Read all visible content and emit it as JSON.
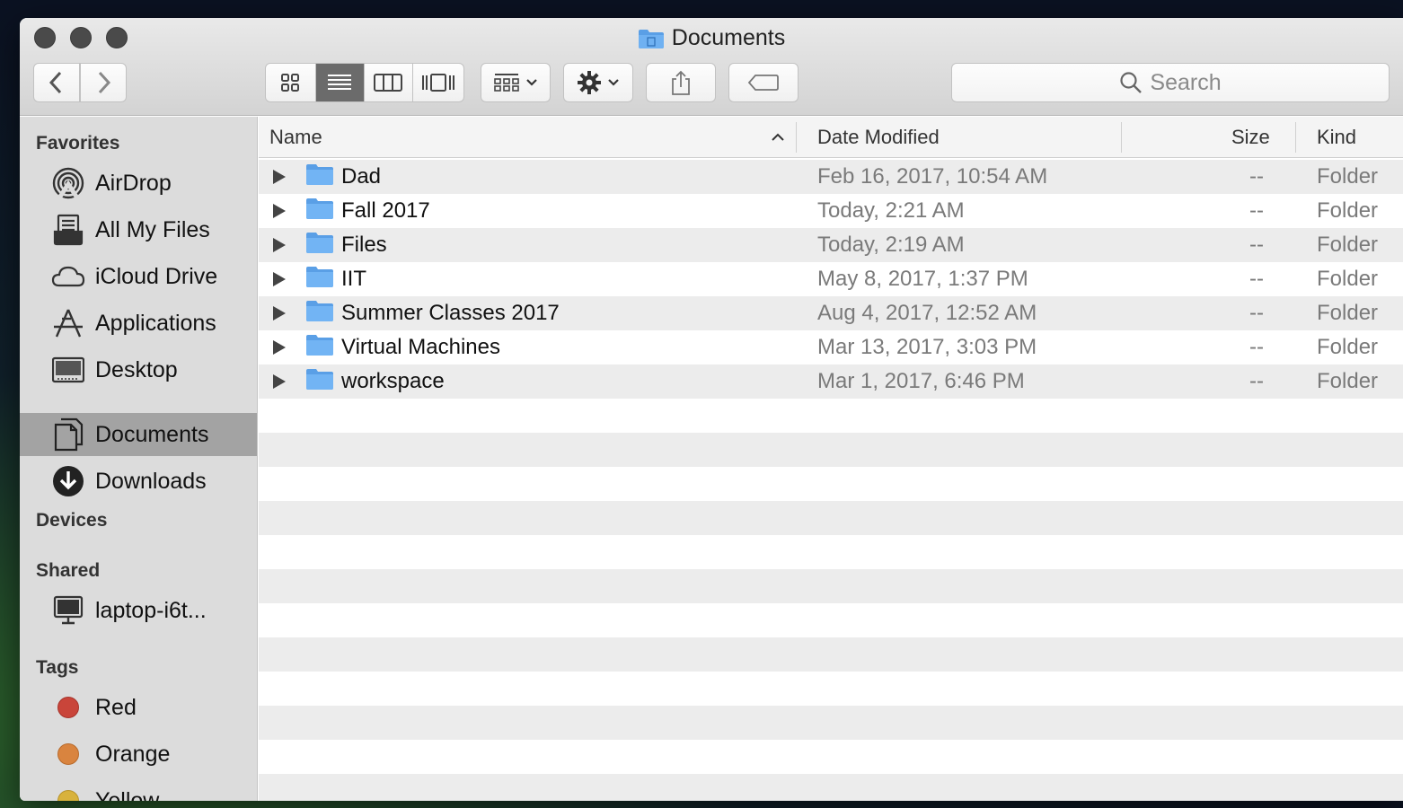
{
  "window": {
    "title": "Documents"
  },
  "toolbar": {
    "back_icon": "chevron-left-icon",
    "forward_icon": "chevron-right-icon",
    "views": [
      "icon-view",
      "list-view",
      "column-view",
      "cover-flow-view"
    ],
    "active_view": "list-view",
    "arrange_icon": "arrange-grid-icon",
    "action_icon": "gear-icon",
    "share_icon": "share-icon",
    "tag_icon": "tag-icon",
    "search_placeholder": "Search"
  },
  "sidebar": {
    "favorites_header": "Favorites",
    "favorites": [
      {
        "label": "AirDrop",
        "icon": "airdrop-icon"
      },
      {
        "label": "All My Files",
        "icon": "all-files-icon"
      },
      {
        "label": "iCloud Drive",
        "icon": "cloud-icon"
      },
      {
        "label": "Applications",
        "icon": "applications-icon"
      },
      {
        "label": "Desktop",
        "icon": "desktop-icon"
      },
      {
        "label": "Documents",
        "icon": "documents-icon",
        "selected": true
      },
      {
        "label": "Downloads",
        "icon": "downloads-icon"
      }
    ],
    "devices_header": "Devices",
    "shared_header": "Shared",
    "shared": [
      {
        "label": "laptop-i6t...",
        "icon": "computer-icon"
      }
    ],
    "tags_header": "Tags",
    "tags": [
      {
        "label": "Red",
        "color": "#c9453a"
      },
      {
        "label": "Orange",
        "color": "#d9843f"
      },
      {
        "label": "Yellow",
        "color": "#d8b23c"
      }
    ]
  },
  "columns": {
    "name": "Name",
    "date": "Date Modified",
    "size": "Size",
    "kind": "Kind",
    "sort_icon": "sort-ascending-icon"
  },
  "files": [
    {
      "name": "Dad",
      "date": "Feb 16, 2017, 10:54 AM",
      "size": "--",
      "kind": "Folder"
    },
    {
      "name": "Fall 2017",
      "date": "Today, 2:21 AM",
      "size": "--",
      "kind": "Folder"
    },
    {
      "name": "Files",
      "date": "Today, 2:19 AM",
      "size": "--",
      "kind": "Folder"
    },
    {
      "name": "IIT",
      "date": "May 8, 2017, 1:37 PM",
      "size": "--",
      "kind": "Folder"
    },
    {
      "name": "Summer Classes 2017",
      "date": "Aug 4, 2017, 12:52 AM",
      "size": "--",
      "kind": "Folder"
    },
    {
      "name": "Virtual Machines",
      "date": "Mar 13, 2017, 3:03 PM",
      "size": "--",
      "kind": "Folder"
    },
    {
      "name": "workspace",
      "date": "Mar 1, 2017, 6:46 PM",
      "size": "--",
      "kind": "Folder"
    }
  ]
}
